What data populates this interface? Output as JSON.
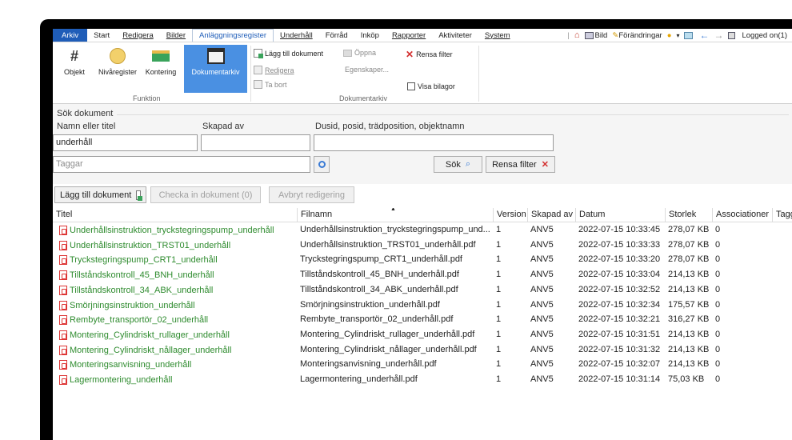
{
  "menu": {
    "tabs": [
      "Arkiv",
      "Start",
      "Redigera",
      "Bilder",
      "Anläggningsregister",
      "Underhåll",
      "Förråd",
      "Inköp",
      "Rapporter",
      "Aktiviteter",
      "System"
    ],
    "right": {
      "bild": "Bild",
      "forandringar": "Förändringar",
      "logged_on": "Logged on(1)"
    }
  },
  "ribbon": {
    "funktion": {
      "label": "Funktion",
      "buttons": [
        "Objekt",
        "Nivåregister",
        "Kontering",
        "Dokumentarkiv"
      ]
    },
    "dokumentarkiv": {
      "label": "Dokumentarkiv",
      "lagg_till": "Lägg till dokument",
      "redigera": "Redigera",
      "ta_bort": "Ta bort",
      "oppna": "Öppna",
      "egenskaper": "Egenskaper...",
      "rensa_filter": "Rensa filter",
      "visa_bilagor": "Visa bilagor"
    }
  },
  "search": {
    "heading": "Sök dokument",
    "namn_label": "Namn eller titel",
    "namn_value": "underhåll",
    "skapad_label": "Skapad av",
    "skapad_value": "",
    "dusid_label": "Dusid, posid, trädposition, objektnamn",
    "dusid_value": "",
    "taggar_placeholder": "Taggar",
    "sok": "Sök",
    "rensa_filter": "Rensa filter"
  },
  "actions": {
    "lagg_till": "Lägg till dokument",
    "checka_in": "Checka in dokument (0)",
    "avbryt": "Avbryt redigering"
  },
  "table": {
    "columns": [
      "Titel",
      "Filnamn",
      "Version",
      "Skapad av",
      "Datum",
      "Storlek",
      "Associationer",
      "Taggar"
    ],
    "rows": [
      [
        "Underhållsinstruktion_tryckstegringspump_underhåll",
        "Underhållsinstruktion_tryckstegringspump_und...",
        "1",
        "ANV5",
        "2022-07-15 10:33:45",
        "278,07 KB",
        "0"
      ],
      [
        "Underhållsinstruktion_TRST01_underhåll",
        "Underhållsinstruktion_TRST01_underhåll.pdf",
        "1",
        "ANV5",
        "2022-07-15 10:33:33",
        "278,07 KB",
        "0"
      ],
      [
        "Tryckstegringspump_CRT1_underhåll",
        "Tryckstegringspump_CRT1_underhåll.pdf",
        "1",
        "ANV5",
        "2022-07-15 10:33:20",
        "278,07 KB",
        "0"
      ],
      [
        "Tillståndskontroll_45_BNH_underhåll",
        "Tillståndskontroll_45_BNH_underhåll.pdf",
        "1",
        "ANV5",
        "2022-07-15 10:33:04",
        "214,13 KB",
        "0"
      ],
      [
        "Tillståndskontroll_34_ABK_underhåll",
        "Tillståndskontroll_34_ABK_underhåll.pdf",
        "1",
        "ANV5",
        "2022-07-15 10:32:52",
        "214,13 KB",
        "0"
      ],
      [
        "Smörjningsinstruktion_underhåll",
        "Smörjningsinstruktion_underhåll.pdf",
        "1",
        "ANV5",
        "2022-07-15 10:32:34",
        "175,57 KB",
        "0"
      ],
      [
        "Rembyte_transportör_02_underhåll",
        "Rembyte_transportör_02_underhåll.pdf",
        "1",
        "ANV5",
        "2022-07-15 10:32:21",
        "316,27 KB",
        "0"
      ],
      [
        "Montering_Cylindriskt_rullager_underhåll",
        "Montering_Cylindriskt_rullager_underhåll.pdf",
        "1",
        "ANV5",
        "2022-07-15 10:31:51",
        "214,13 KB",
        "0"
      ],
      [
        "Montering_Cylindriskt_nållager_underhåll",
        "Montering_Cylindriskt_nållager_underhåll.pdf",
        "1",
        "ANV5",
        "2022-07-15 10:31:32",
        "214,13 KB",
        "0"
      ],
      [
        "Monteringsanvisning_underhåll",
        "Monteringsanvisning_underhåll.pdf",
        "1",
        "ANV5",
        "2022-07-15 10:32:07",
        "214,13 KB",
        "0"
      ],
      [
        "Lagermontering_underhåll",
        "Lagermontering_underhåll.pdf",
        "1",
        "ANV5",
        "2022-07-15 10:31:14",
        "75,03 KB",
        "0"
      ]
    ]
  },
  "colors": {
    "accent": "#1f5db8",
    "selected": "#4a90e2",
    "title_green": "#2e8b2e",
    "pdf_red": "#d33333"
  }
}
